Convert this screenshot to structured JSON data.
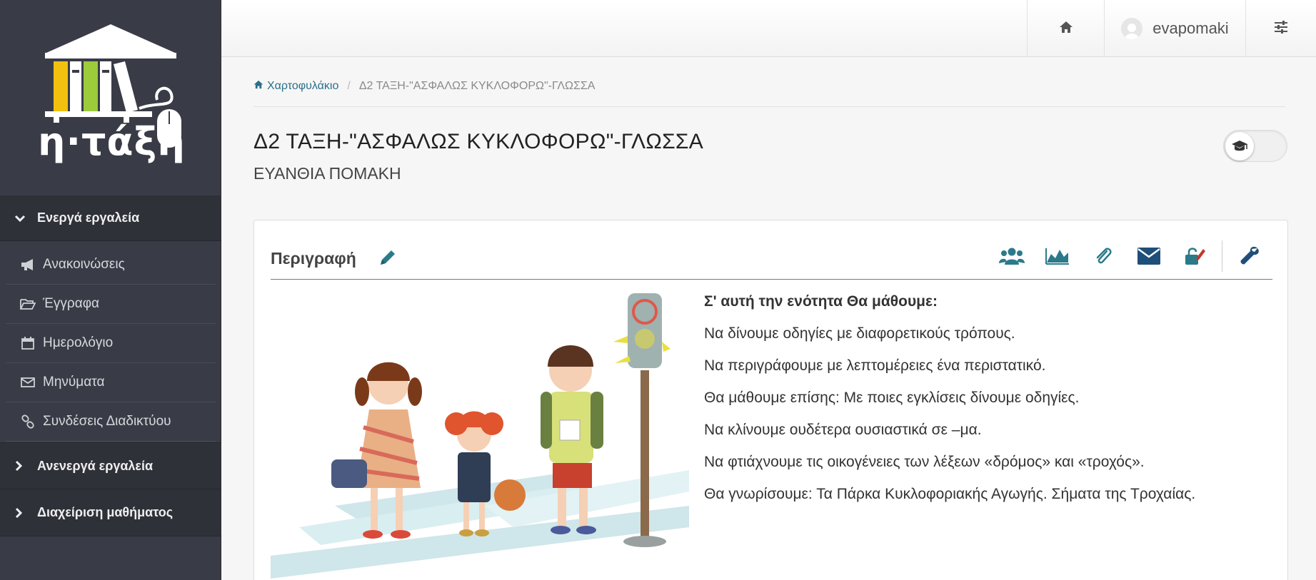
{
  "sidebar": {
    "logo_text": "η·τάξη",
    "active_group": "Ενεργά εργαλεία",
    "tools": [
      {
        "label": "Ανακοινώσεις",
        "icon": "megaphone-icon"
      },
      {
        "label": "Έγγραφα",
        "icon": "folder-open-icon"
      },
      {
        "label": "Ημερολόγιο",
        "icon": "calendar-icon"
      },
      {
        "label": "Μηνύματα",
        "icon": "envelope-icon"
      },
      {
        "label": "Συνδέσεις Διαδικτύου",
        "icon": "link-icon"
      }
    ],
    "inactive_group": "Ανενεργά εργαλεία",
    "admin_group": "Διαχείριση μαθήματος"
  },
  "topbar": {
    "username": "evapomaki"
  },
  "breadcrumb": {
    "home": "Χαρτοφυλάκιο",
    "current": "Δ2 ΤΑΞΗ-\"ΑΣΦΑΛΩΣ ΚΥΚΛΟΦΟΡΩ\"-ΓΛΩΣΣΑ"
  },
  "course": {
    "title": "Δ2 ΤΑΞΗ-\"ΑΣΦΑΛΩΣ ΚΥΚΛΟΦΟΡΩ\"-ΓΛΩΣΣΑ",
    "teacher": "ΕΥΑΝΘΙΑ ΠΟΜΑΚΗ"
  },
  "panel": {
    "title": "Περιγραφή",
    "description": {
      "heading": "Σ' αυτή την ενότητα Θα μάθουμε:",
      "lines": [
        "Να δίνουμε οδηγίες με διαφορετικούς τρόπους.",
        "Να περιγράφουμε με λεπτομέρειες ένα περιστατικό.",
        "Θα μάθουμε επίσης: Με ποιες εγκλίσεις δίνουμε οδηγίες.",
        "Να κλίνουμε ουδέτερα ουσιαστικά σε –μα.",
        "Να φτιάχνουμε τις οικογένειες των λέξεων «δρόμος» και «τροχός».",
        "Θα γνωρίσουμε: Τα Πάρκα Κυκλοφοριακής Αγωγής. Σήματα της Τροχαίας."
      ]
    }
  },
  "colors": {
    "sidebar_bg": "#393c46",
    "accent_teal": "#2b7a8a",
    "accent_navy": "#1f4e79"
  }
}
